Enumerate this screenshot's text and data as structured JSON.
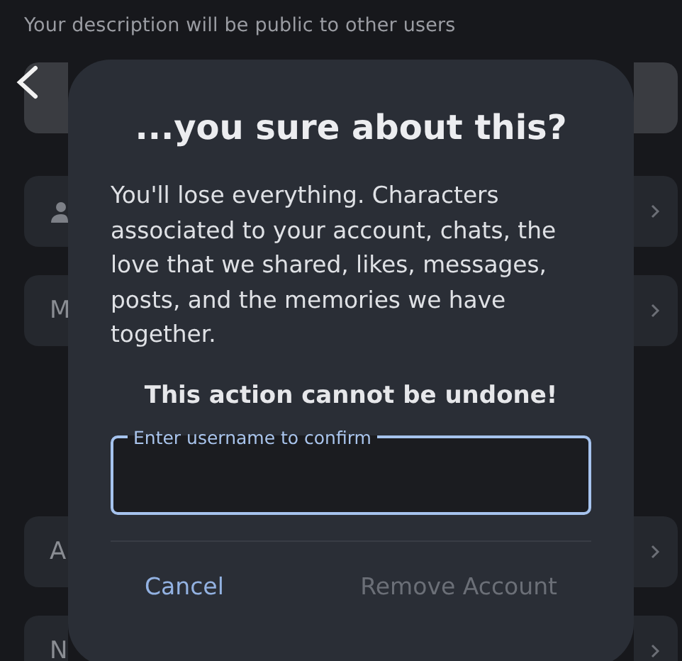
{
  "background": {
    "hint": "Your description will be public to other users",
    "rows": [
      {
        "kind": "field",
        "label": ""
      },
      {
        "kind": "icon",
        "label": ""
      },
      {
        "kind": "text",
        "label": "M"
      },
      {
        "kind": "spacer",
        "label": ""
      },
      {
        "kind": "text",
        "label": "A"
      },
      {
        "kind": "text",
        "label": "N"
      }
    ]
  },
  "dialog": {
    "title": "...you sure about this?",
    "message": "You'll lose everything. Characters associated to your account, chats, the love that we shared, likes, messages, posts, and the memories we have together.",
    "warning": "This action cannot be undone!",
    "field": {
      "label": "Enter username to confirm",
      "focused": true
    },
    "buttons": [
      {
        "label": "Cancel",
        "disabled": false
      },
      {
        "label": "Remove Account",
        "disabled": true
      }
    ]
  }
}
